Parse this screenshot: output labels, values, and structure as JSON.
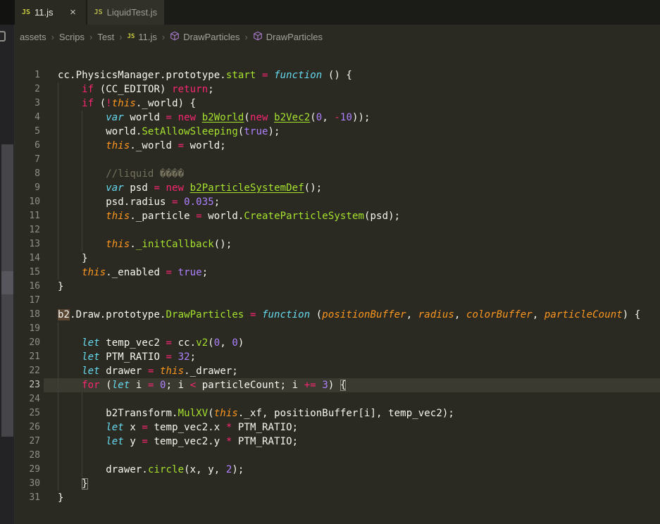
{
  "colors": {
    "editor_bg": "#2a2a22",
    "tabbar_bg": "#1b1b18",
    "inactive_tab_bg": "#31312a",
    "current_line_bg": "#3a3a30",
    "keyword_pink": "#f92672",
    "storage_cyan": "#66d9ef",
    "function_green": "#a6e22e",
    "param_orange": "#fd971f",
    "number_purple": "#ae81ff",
    "comment_gray": "#75715e",
    "symbol_purple": "#b180d7",
    "js_icon_yellow": "#cbcb41"
  },
  "tabs": [
    {
      "label": "11.js",
      "icon": "js-file-icon",
      "active": true,
      "close_glyph": "×"
    },
    {
      "label": "LiquidTest.js",
      "icon": "js-file-icon",
      "active": false,
      "close_glyph": ""
    }
  ],
  "breadcrumb": {
    "separator": "›",
    "items": [
      {
        "label": "assets",
        "icon": "none"
      },
      {
        "label": "Scrips",
        "icon": "none"
      },
      {
        "label": "Test",
        "icon": "none"
      },
      {
        "label": "11.js",
        "icon": "js"
      },
      {
        "label": "DrawParticles",
        "icon": "method"
      },
      {
        "label": "DrawParticles",
        "icon": "method"
      }
    ]
  },
  "editor": {
    "active_line": 23,
    "indent_guides": [
      {
        "col": 0,
        "from": 2,
        "to": 15
      },
      {
        "col": 4,
        "from": 4,
        "to": 13
      },
      {
        "col": 0,
        "from": 19,
        "to": 30
      },
      {
        "col": 4,
        "from": 24,
        "to": 29
      }
    ],
    "lines": [
      {
        "n": 1,
        "segs": [
          [
            "w",
            "cc.PhysicsManager.prototype."
          ],
          [
            "f",
            "start"
          ],
          [
            "w",
            " "
          ],
          [
            "k",
            "="
          ],
          [
            "w",
            " "
          ],
          [
            "s",
            "function"
          ],
          [
            "w",
            " () {"
          ]
        ]
      },
      {
        "n": 2,
        "segs": [
          [
            "w",
            "    "
          ],
          [
            "k",
            "if"
          ],
          [
            "w",
            " (CC_EDITOR) "
          ],
          [
            "k",
            "return"
          ],
          [
            "w",
            ";"
          ]
        ]
      },
      {
        "n": 3,
        "segs": [
          [
            "w",
            "    "
          ],
          [
            "k",
            "if"
          ],
          [
            "w",
            " ("
          ],
          [
            "k",
            "!"
          ],
          [
            "th",
            "this"
          ],
          [
            "w",
            "._world) {"
          ]
        ]
      },
      {
        "n": 4,
        "segs": [
          [
            "w",
            "        "
          ],
          [
            "s",
            "var"
          ],
          [
            "w",
            " world "
          ],
          [
            "k",
            "="
          ],
          [
            "w",
            " "
          ],
          [
            "k",
            "new"
          ],
          [
            "w",
            " "
          ],
          [
            "fu",
            "b2World"
          ],
          [
            "w",
            "("
          ],
          [
            "k",
            "new"
          ],
          [
            "w",
            " "
          ],
          [
            "fu",
            "b2Vec2"
          ],
          [
            "w",
            "("
          ],
          [
            "n",
            "0"
          ],
          [
            "w",
            ", "
          ],
          [
            "k",
            "-"
          ],
          [
            "n",
            "10"
          ],
          [
            "w",
            "));"
          ]
        ]
      },
      {
        "n": 5,
        "segs": [
          [
            "w",
            "        world."
          ],
          [
            "f",
            "SetAllowSleeping"
          ],
          [
            "w",
            "("
          ],
          [
            "n",
            "true"
          ],
          [
            "w",
            ");"
          ]
        ]
      },
      {
        "n": 6,
        "segs": [
          [
            "w",
            "        "
          ],
          [
            "th",
            "this"
          ],
          [
            "w",
            "._world "
          ],
          [
            "k",
            "="
          ],
          [
            "w",
            " world;"
          ]
        ]
      },
      {
        "n": 7,
        "segs": []
      },
      {
        "n": 8,
        "segs": [
          [
            "w",
            "        "
          ],
          [
            "c",
            "//liquid ����"
          ]
        ]
      },
      {
        "n": 9,
        "segs": [
          [
            "w",
            "        "
          ],
          [
            "s",
            "var"
          ],
          [
            "w",
            " psd "
          ],
          [
            "k",
            "="
          ],
          [
            "w",
            " "
          ],
          [
            "k",
            "new"
          ],
          [
            "w",
            " "
          ],
          [
            "fu",
            "b2ParticleSystemDef"
          ],
          [
            "w",
            "();"
          ]
        ]
      },
      {
        "n": 10,
        "segs": [
          [
            "w",
            "        psd.radius "
          ],
          [
            "k",
            "="
          ],
          [
            "w",
            " "
          ],
          [
            "n",
            "0.035"
          ],
          [
            "w",
            ";"
          ]
        ]
      },
      {
        "n": 11,
        "segs": [
          [
            "w",
            "        "
          ],
          [
            "th",
            "this"
          ],
          [
            "w",
            "._particle "
          ],
          [
            "k",
            "="
          ],
          [
            "w",
            " world."
          ],
          [
            "f",
            "CreateParticleSystem"
          ],
          [
            "w",
            "(psd);"
          ]
        ]
      },
      {
        "n": 12,
        "segs": []
      },
      {
        "n": 13,
        "segs": [
          [
            "w",
            "        "
          ],
          [
            "th",
            "this"
          ],
          [
            "w",
            "."
          ],
          [
            "f",
            "_initCallback"
          ],
          [
            "w",
            "();"
          ]
        ]
      },
      {
        "n": 14,
        "segs": [
          [
            "w",
            "    }"
          ]
        ]
      },
      {
        "n": 15,
        "segs": [
          [
            "w",
            "    "
          ],
          [
            "th",
            "this"
          ],
          [
            "w",
            "._enabled "
          ],
          [
            "k",
            "="
          ],
          [
            "w",
            " "
          ],
          [
            "n",
            "true"
          ],
          [
            "w",
            ";"
          ]
        ]
      },
      {
        "n": 16,
        "segs": [
          [
            "w",
            "}"
          ]
        ]
      },
      {
        "n": 17,
        "segs": []
      },
      {
        "n": 18,
        "segs": [
          [
            "hl",
            "b2"
          ],
          [
            "w",
            ".Draw.prototype."
          ],
          [
            "f",
            "DrawParticles"
          ],
          [
            "w",
            " "
          ],
          [
            "k",
            "="
          ],
          [
            "w",
            " "
          ],
          [
            "s",
            "function"
          ],
          [
            "w",
            " ("
          ],
          [
            "p",
            "positionBuffer"
          ],
          [
            "w",
            ", "
          ],
          [
            "p",
            "radius"
          ],
          [
            "w",
            ", "
          ],
          [
            "p",
            "colorBuffer"
          ],
          [
            "w",
            ", "
          ],
          [
            "p",
            "particleCount"
          ],
          [
            "w",
            ") {"
          ]
        ]
      },
      {
        "n": 19,
        "segs": []
      },
      {
        "n": 20,
        "segs": [
          [
            "w",
            "    "
          ],
          [
            "s",
            "let"
          ],
          [
            "w",
            " temp_vec2 "
          ],
          [
            "k",
            "="
          ],
          [
            "w",
            " cc."
          ],
          [
            "f",
            "v2"
          ],
          [
            "w",
            "("
          ],
          [
            "n",
            "0"
          ],
          [
            "w",
            ", "
          ],
          [
            "n",
            "0"
          ],
          [
            "w",
            ")"
          ]
        ]
      },
      {
        "n": 21,
        "segs": [
          [
            "w",
            "    "
          ],
          [
            "s",
            "let"
          ],
          [
            "w",
            " PTM_RATIO "
          ],
          [
            "k",
            "="
          ],
          [
            "w",
            " "
          ],
          [
            "n",
            "32"
          ],
          [
            "w",
            ";"
          ]
        ]
      },
      {
        "n": 22,
        "segs": [
          [
            "w",
            "    "
          ],
          [
            "s",
            "let"
          ],
          [
            "w",
            " drawer "
          ],
          [
            "k",
            "="
          ],
          [
            "w",
            " "
          ],
          [
            "th",
            "this"
          ],
          [
            "w",
            "._drawer;"
          ]
        ]
      },
      {
        "n": 23,
        "segs": [
          [
            "w",
            "    "
          ],
          [
            "k",
            "for"
          ],
          [
            "w",
            " ("
          ],
          [
            "s",
            "let"
          ],
          [
            "w",
            " i "
          ],
          [
            "k",
            "="
          ],
          [
            "w",
            " "
          ],
          [
            "n",
            "0"
          ],
          [
            "w",
            "; i "
          ],
          [
            "k",
            "<"
          ],
          [
            "w",
            " particleCount; i "
          ],
          [
            "k",
            "+="
          ],
          [
            "w",
            " "
          ],
          [
            "n",
            "3"
          ],
          [
            "w",
            ") "
          ],
          [
            "bm",
            "{"
          ]
        ]
      },
      {
        "n": 24,
        "segs": []
      },
      {
        "n": 25,
        "segs": [
          [
            "w",
            "        b2Transform."
          ],
          [
            "f",
            "MulXV"
          ],
          [
            "w",
            "("
          ],
          [
            "th",
            "this"
          ],
          [
            "w",
            "._xf, positionBuffer[i], temp_vec2);"
          ]
        ]
      },
      {
        "n": 26,
        "segs": [
          [
            "w",
            "        "
          ],
          [
            "s",
            "let"
          ],
          [
            "w",
            " x "
          ],
          [
            "k",
            "="
          ],
          [
            "w",
            " temp_vec2.x "
          ],
          [
            "k",
            "*"
          ],
          [
            "w",
            " PTM_RATIO;"
          ]
        ]
      },
      {
        "n": 27,
        "segs": [
          [
            "w",
            "        "
          ],
          [
            "s",
            "let"
          ],
          [
            "w",
            " y "
          ],
          [
            "k",
            "="
          ],
          [
            "w",
            " temp_vec2.y "
          ],
          [
            "k",
            "*"
          ],
          [
            "w",
            " PTM_RATIO;"
          ]
        ]
      },
      {
        "n": 28,
        "segs": []
      },
      {
        "n": 29,
        "segs": [
          [
            "w",
            "        drawer."
          ],
          [
            "f",
            "circle"
          ],
          [
            "w",
            "(x, y, "
          ],
          [
            "n",
            "2"
          ],
          [
            "w",
            ");"
          ]
        ]
      },
      {
        "n": 30,
        "segs": [
          [
            "w",
            "    "
          ],
          [
            "bm",
            "}"
          ]
        ]
      },
      {
        "n": 31,
        "segs": [
          [
            "w",
            "}"
          ]
        ]
      }
    ]
  }
}
